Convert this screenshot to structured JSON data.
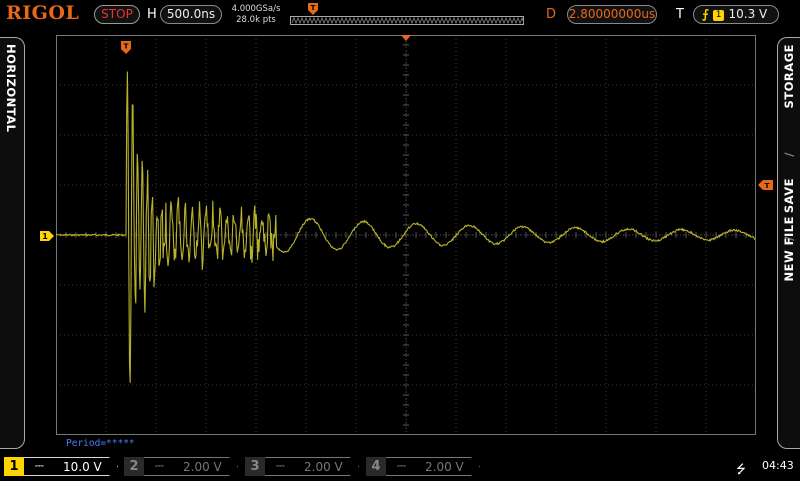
{
  "header": {
    "brand": "RIGOL",
    "run_state": "STOP",
    "horizontal_label": "H",
    "timebase": "500.0ns",
    "sample_rate": "4.000GSa/s",
    "memory_depth": "28.0k pts",
    "delay_label": "D",
    "delay_value": "2.80000000us",
    "trigger_label": "T",
    "trigger_source": "1",
    "trigger_level": "10.3 V",
    "trigger_marker": "T"
  },
  "left_tab": {
    "label": "HORIZONTAL"
  },
  "right_tab": {
    "items": [
      "STORAGE",
      "/",
      "SAVE",
      "/",
      "NEW FILE"
    ]
  },
  "screen": {
    "grid_divisions": {
      "horizontal": 14,
      "vertical": 8
    },
    "ch1_marker": "1",
    "trigger_pos_marker": "T",
    "trigger_level_marker": "T",
    "measurement": "Period=*****"
  },
  "channels": [
    {
      "number": "1",
      "coupling": "DC",
      "scale": "10.0 V",
      "enabled": true
    },
    {
      "number": "2",
      "coupling": "DC",
      "scale": "2.00 V",
      "enabled": false
    },
    {
      "number": "3",
      "coupling": "DC",
      "scale": "2.00 V",
      "enabled": false
    },
    {
      "number": "4",
      "coupling": "DC",
      "scale": "2.00 V",
      "enabled": false
    }
  ],
  "status": {
    "usb": "usb-icon",
    "time": "04:43"
  },
  "colors": {
    "brand": "#e8681a",
    "ch1": "#ffd400",
    "trace": "#b8b22c",
    "grid": "#3a3a3a",
    "run_state": "#e33333",
    "measurement": "#4a7bff"
  }
}
